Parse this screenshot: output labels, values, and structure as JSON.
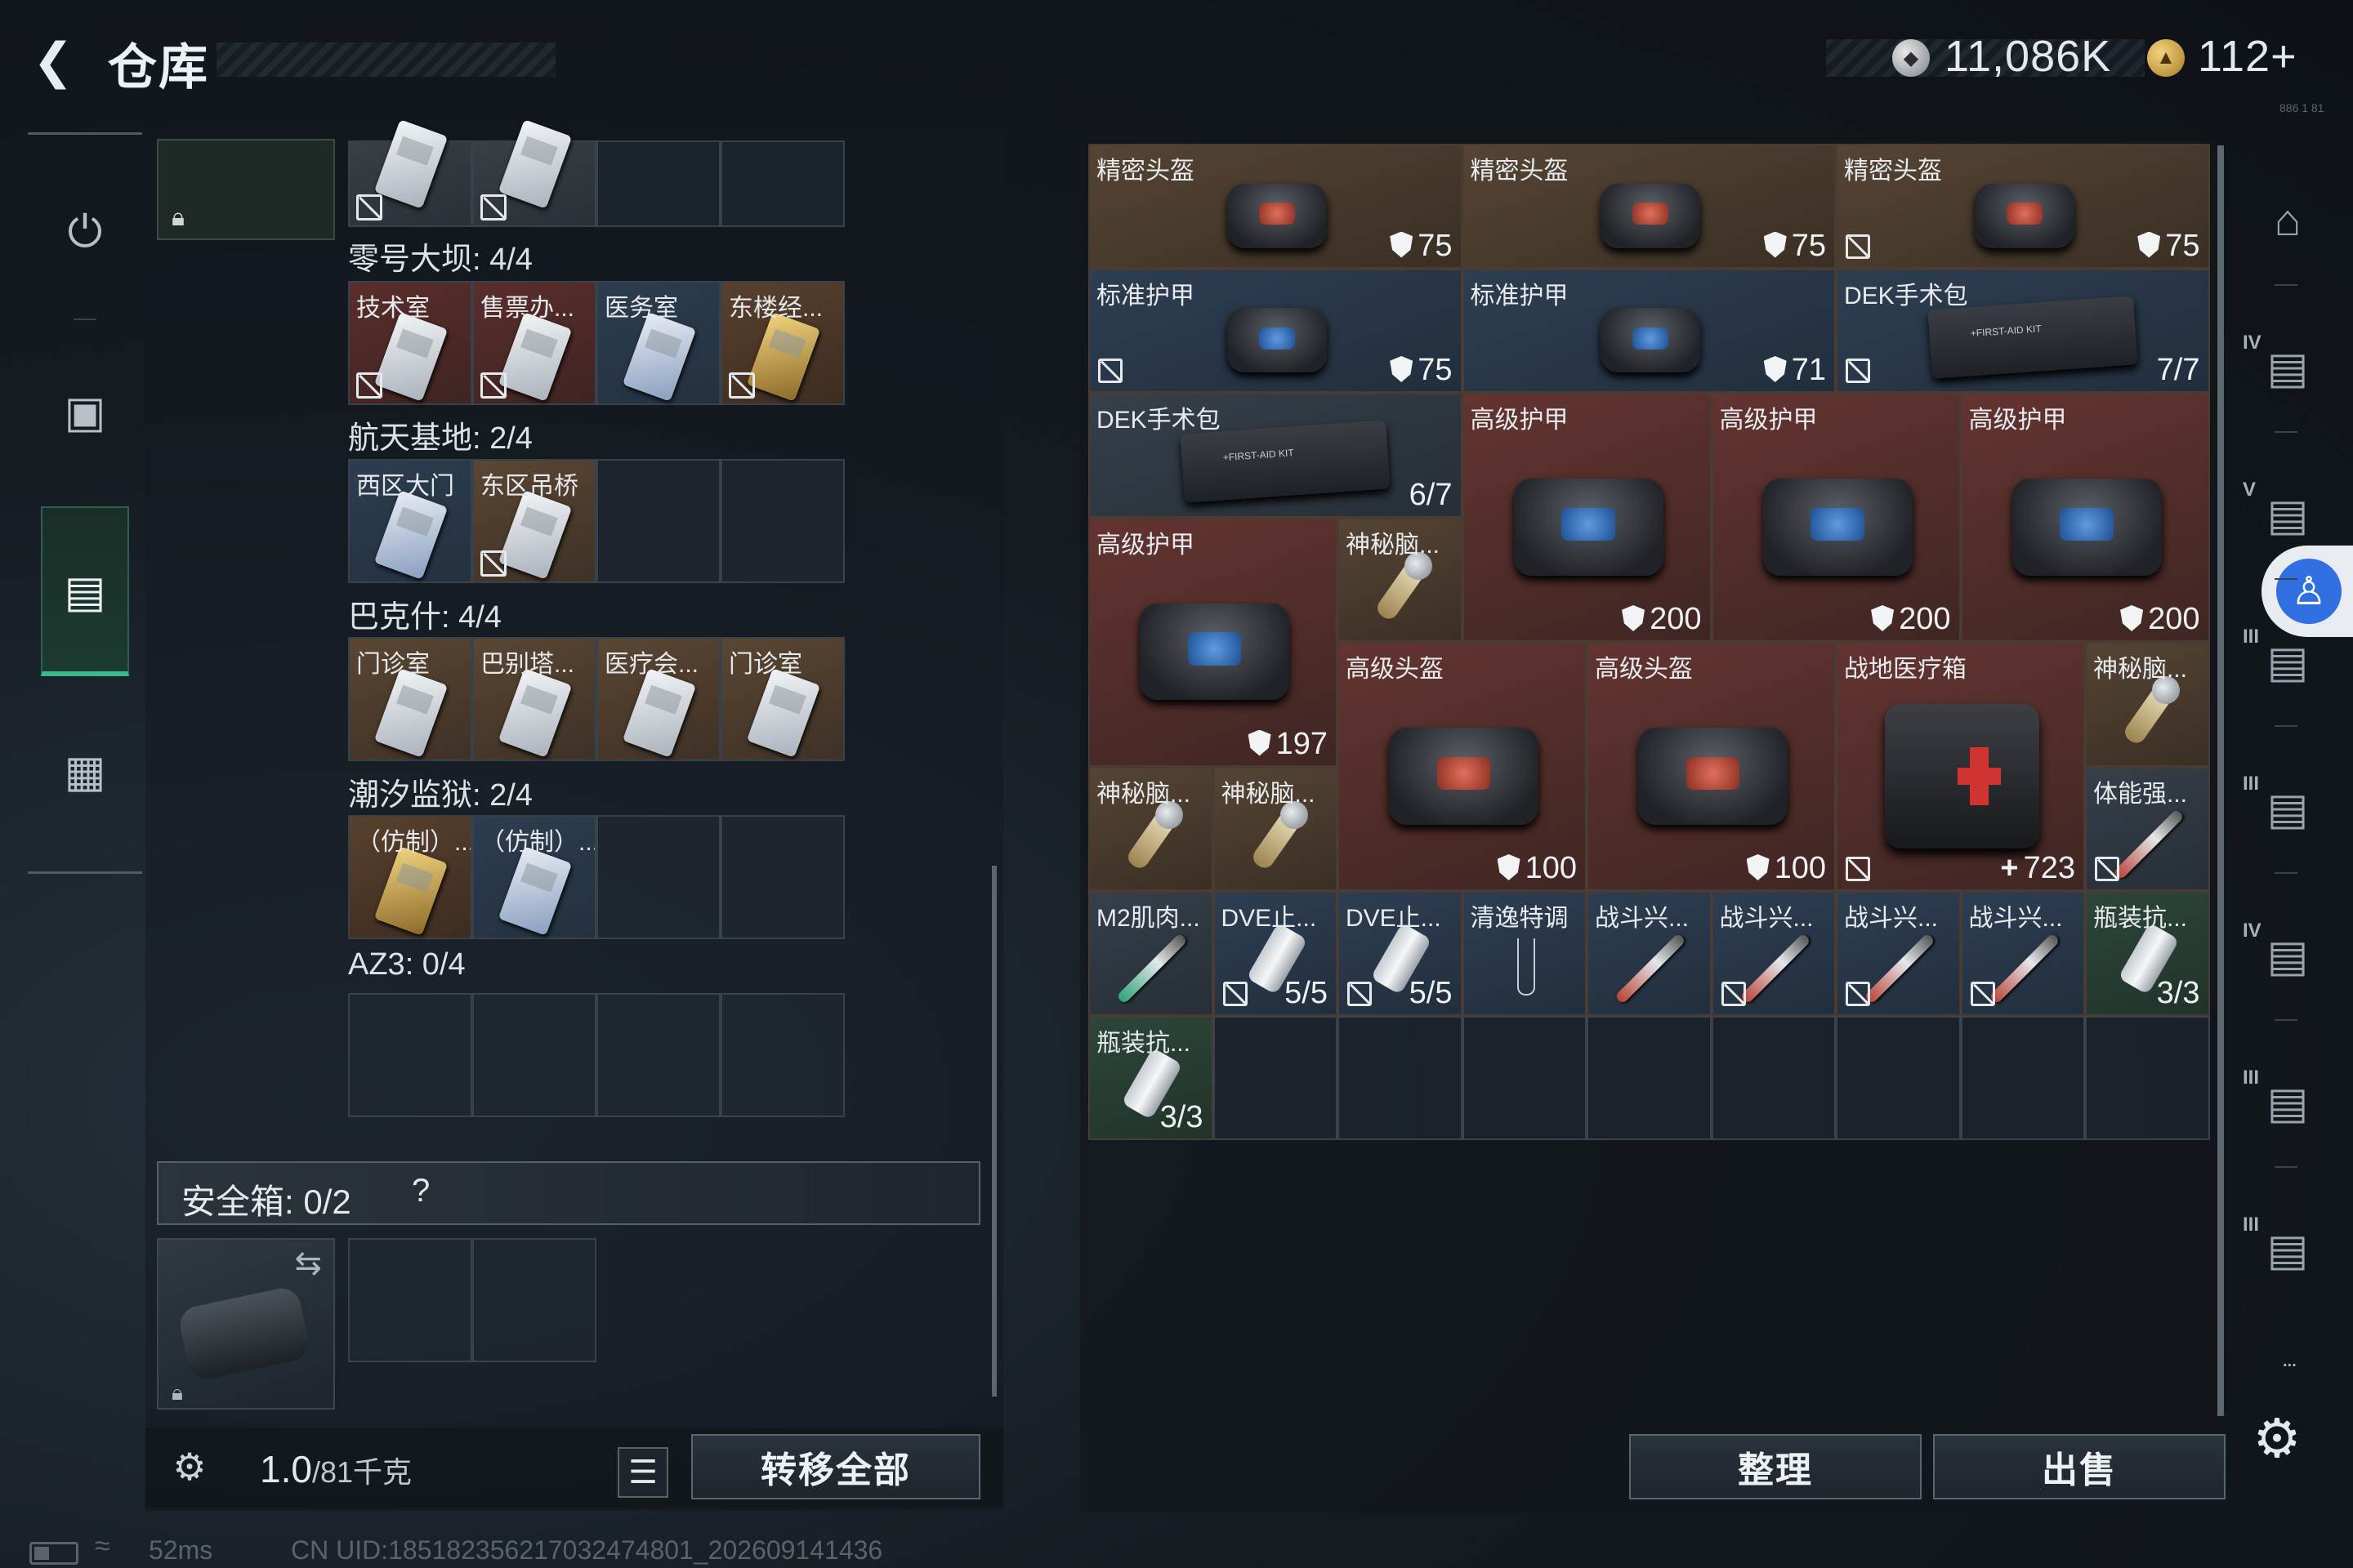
{
  "header": {
    "back_icon": "back-arrow-icon",
    "title": "仓库",
    "currency1_icon": "silver-coin-icon",
    "currency1": "11,086K",
    "currency2_icon": "gold-coin-icon",
    "currency2": "112+",
    "tiny_text": "886 1 81"
  },
  "left_nav": [
    "rifle-icon",
    "backpack-icon",
    "vest-icon",
    "toolbox-icon"
  ],
  "storage": {
    "top_row_partial": [
      "",
      ""
    ],
    "groups": [
      {
        "title": "零号大坝: 4/4",
        "items": [
          {
            "label": "技术室",
            "tone": "red",
            "bound": true
          },
          {
            "label": "售票办...",
            "tone": "red",
            "bound": true
          },
          {
            "label": "医务室",
            "tone": "blue",
            "bound": false
          },
          {
            "label": "东楼经...",
            "tone": "gold",
            "bound": true
          }
        ]
      },
      {
        "title": "航天基地: 2/4",
        "items": [
          {
            "label": "西区大门",
            "tone": "blue",
            "bound": false
          },
          {
            "label": "东区吊桥",
            "tone": "brown",
            "bound": true
          }
        ]
      },
      {
        "title": "巴克什: 4/4",
        "items": [
          {
            "label": "门诊室",
            "tone": "brown",
            "bound": false
          },
          {
            "label": "巴别塔...",
            "tone": "brown",
            "bound": false
          },
          {
            "label": "医疗会...",
            "tone": "brown",
            "bound": false
          },
          {
            "label": "门诊室",
            "tone": "brown",
            "bound": false
          }
        ]
      },
      {
        "title": "潮汐监狱: 2/4",
        "items": [
          {
            "label": "（仿制）...",
            "tone": "gold",
            "bound": false
          },
          {
            "label": "（仿制）...",
            "tone": "blue",
            "bound": false
          }
        ]
      },
      {
        "title": "AZ3: 0/4",
        "items": []
      }
    ]
  },
  "safe_box": {
    "label": "安全箱: 0/2",
    "help": "?"
  },
  "bottom": {
    "weight_value": "1.0",
    "weight_unit": "/81千克",
    "transfer": "转移全部",
    "list_icon": "list-icon"
  },
  "status": {
    "ping": "52ms",
    "uid": "CN UID:185182356217032474801_202609141436"
  },
  "inventory": [
    {
      "name": "精密头盔",
      "val": "75",
      "kind": "helmet-red",
      "tone": "brown",
      "sym": "shield",
      "bound": false
    },
    {
      "name": "精密头盔",
      "val": "75",
      "kind": "helmet-red",
      "tone": "brown",
      "sym": "shield",
      "bound": false
    },
    {
      "name": "精密头盔",
      "val": "75",
      "kind": "helmet-red",
      "tone": "brown",
      "sym": "shield",
      "bound": true
    },
    {
      "name": "标准护甲",
      "val": "75",
      "kind": "armor",
      "tone": "blue",
      "sym": "shield",
      "bound": true
    },
    {
      "name": "标准护甲",
      "val": "71",
      "kind": "armor",
      "tone": "blue",
      "sym": "shield",
      "bound": false
    },
    {
      "name": "DEK手术包",
      "val": "7/7",
      "kind": "kit",
      "tone": "blue",
      "sym": "",
      "bound": true
    },
    {
      "name": "DEK手术包",
      "val": "6/7",
      "kind": "kit",
      "tone": "gray",
      "sym": "",
      "bound": false
    },
    {
      "name": "高级护甲",
      "val": "200",
      "kind": "armor",
      "tone": "red",
      "sym": "shield",
      "bound": false
    },
    {
      "name": "高级护甲",
      "val": "200",
      "kind": "armor",
      "tone": "red",
      "sym": "shield",
      "bound": false
    },
    {
      "name": "高级护甲",
      "val": "200",
      "kind": "armor",
      "tone": "red",
      "sym": "shield",
      "bound": false
    },
    {
      "name": "高级护甲",
      "val": "197",
      "kind": "armor",
      "tone": "red",
      "sym": "shield",
      "bound": false
    },
    {
      "name": "神秘脑...",
      "val": "",
      "kind": "brain",
      "tone": "brown",
      "sym": "",
      "bound": false
    },
    {
      "name": "高级头盔",
      "val": "100",
      "kind": "helmet-red",
      "tone": "red",
      "sym": "shield",
      "bound": false
    },
    {
      "name": "高级头盔",
      "val": "100",
      "kind": "helmet-red",
      "tone": "red",
      "sym": "shield",
      "bound": false
    },
    {
      "name": "战地医疗箱",
      "val": "723",
      "kind": "medbox",
      "tone": "red",
      "sym": "plus",
      "bound": true
    },
    {
      "name": "神秘脑...",
      "val": "",
      "kind": "brain",
      "tone": "brown",
      "sym": "",
      "bound": false
    },
    {
      "name": "神秘脑...",
      "val": "",
      "kind": "brain",
      "tone": "brown",
      "sym": "",
      "bound": false
    },
    {
      "name": "神秘脑...",
      "val": "",
      "kind": "brain",
      "tone": "brown",
      "sym": "",
      "bound": false
    },
    {
      "name": "体能强...",
      "val": "",
      "kind": "stick-red",
      "tone": "gray",
      "sym": "",
      "bound": true
    },
    {
      "name": "M2肌肉...",
      "val": "",
      "kind": "stick-green",
      "tone": "gray",
      "sym": "",
      "bound": false
    },
    {
      "name": "DVE止...",
      "val": "5/5",
      "kind": "bottle",
      "tone": "blue",
      "sym": "",
      "bound": true
    },
    {
      "name": "DVE止...",
      "val": "5/5",
      "kind": "bottle",
      "tone": "blue",
      "sym": "",
      "bound": true
    },
    {
      "name": "清逸特调",
      "val": "",
      "kind": "glass",
      "tone": "blue",
      "sym": "",
      "bound": false
    },
    {
      "name": "战斗兴...",
      "val": "",
      "kind": "stick-red",
      "tone": "blue",
      "sym": "",
      "bound": false
    },
    {
      "name": "战斗兴...",
      "val": "",
      "kind": "stick-red",
      "tone": "blue",
      "sym": "",
      "bound": true
    },
    {
      "name": "战斗兴...",
      "val": "",
      "kind": "stick-red",
      "tone": "blue",
      "sym": "",
      "bound": true
    },
    {
      "name": "战斗兴...",
      "val": "",
      "kind": "stick-red",
      "tone": "blue",
      "sym": "",
      "bound": true
    },
    {
      "name": "瓶装抗...",
      "val": "3/3",
      "kind": "bottle",
      "tone": "green",
      "sym": "",
      "bound": false
    },
    {
      "name": "瓶装抗...",
      "val": "3/3",
      "kind": "bottle",
      "tone": "green",
      "sym": "",
      "bound": false
    }
  ],
  "actions": {
    "organize": "整理",
    "sell": "出售"
  },
  "right_rail": [
    {
      "icon": "helmet-slot-icon",
      "text": ""
    },
    {
      "icon": "armor-slot-icon",
      "text": "IV"
    },
    {
      "icon": "vest-slot-icon",
      "text": "V"
    },
    {
      "icon": "bag-slot-icon",
      "text": "III"
    },
    {
      "icon": "weapon-slot-icon",
      "text": "III"
    },
    {
      "icon": "med-slot-icon",
      "text": "IV"
    },
    {
      "icon": "bag-slot-icon",
      "text": "III"
    },
    {
      "icon": "misc-slot-icon",
      "text": "III"
    }
  ],
  "rail_more": "...",
  "accessibility_icon": "accessibility-icon",
  "settings_icon": "gear-icon",
  "colors": {
    "accent_green": "#3bb88d",
    "item_red": "#633431",
    "item_blue": "#2e3e52",
    "item_brown": "#554434"
  }
}
